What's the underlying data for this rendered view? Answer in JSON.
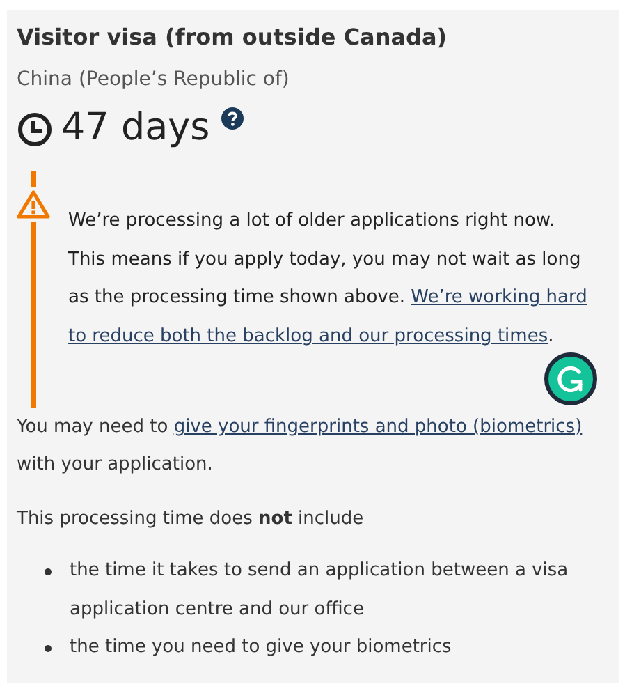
{
  "title": "Visitor visa (from outside Canada)",
  "country": "China (People’s Republic of)",
  "processing_time": "47 days",
  "warning": {
    "text": "We’re processing a lot of older applications right now. This means if you apply today, you may not wait as long as the processing time shown above. ",
    "link_lines": [
      "We’re working hard",
      "to reduce both the backlog and our processing times"
    ],
    "after": "."
  },
  "biometrics_note": {
    "text": "You may need to ",
    "link": "give your fingerprints and photo (biometrics)",
    "after": " with your application."
  },
  "exclusions_intro": "This processing time does **not** include",
  "exclusions": [
    "the time it takes to send an application between a visa application centre and our office",
    "the time you need to give your biometrics"
  ]
}
